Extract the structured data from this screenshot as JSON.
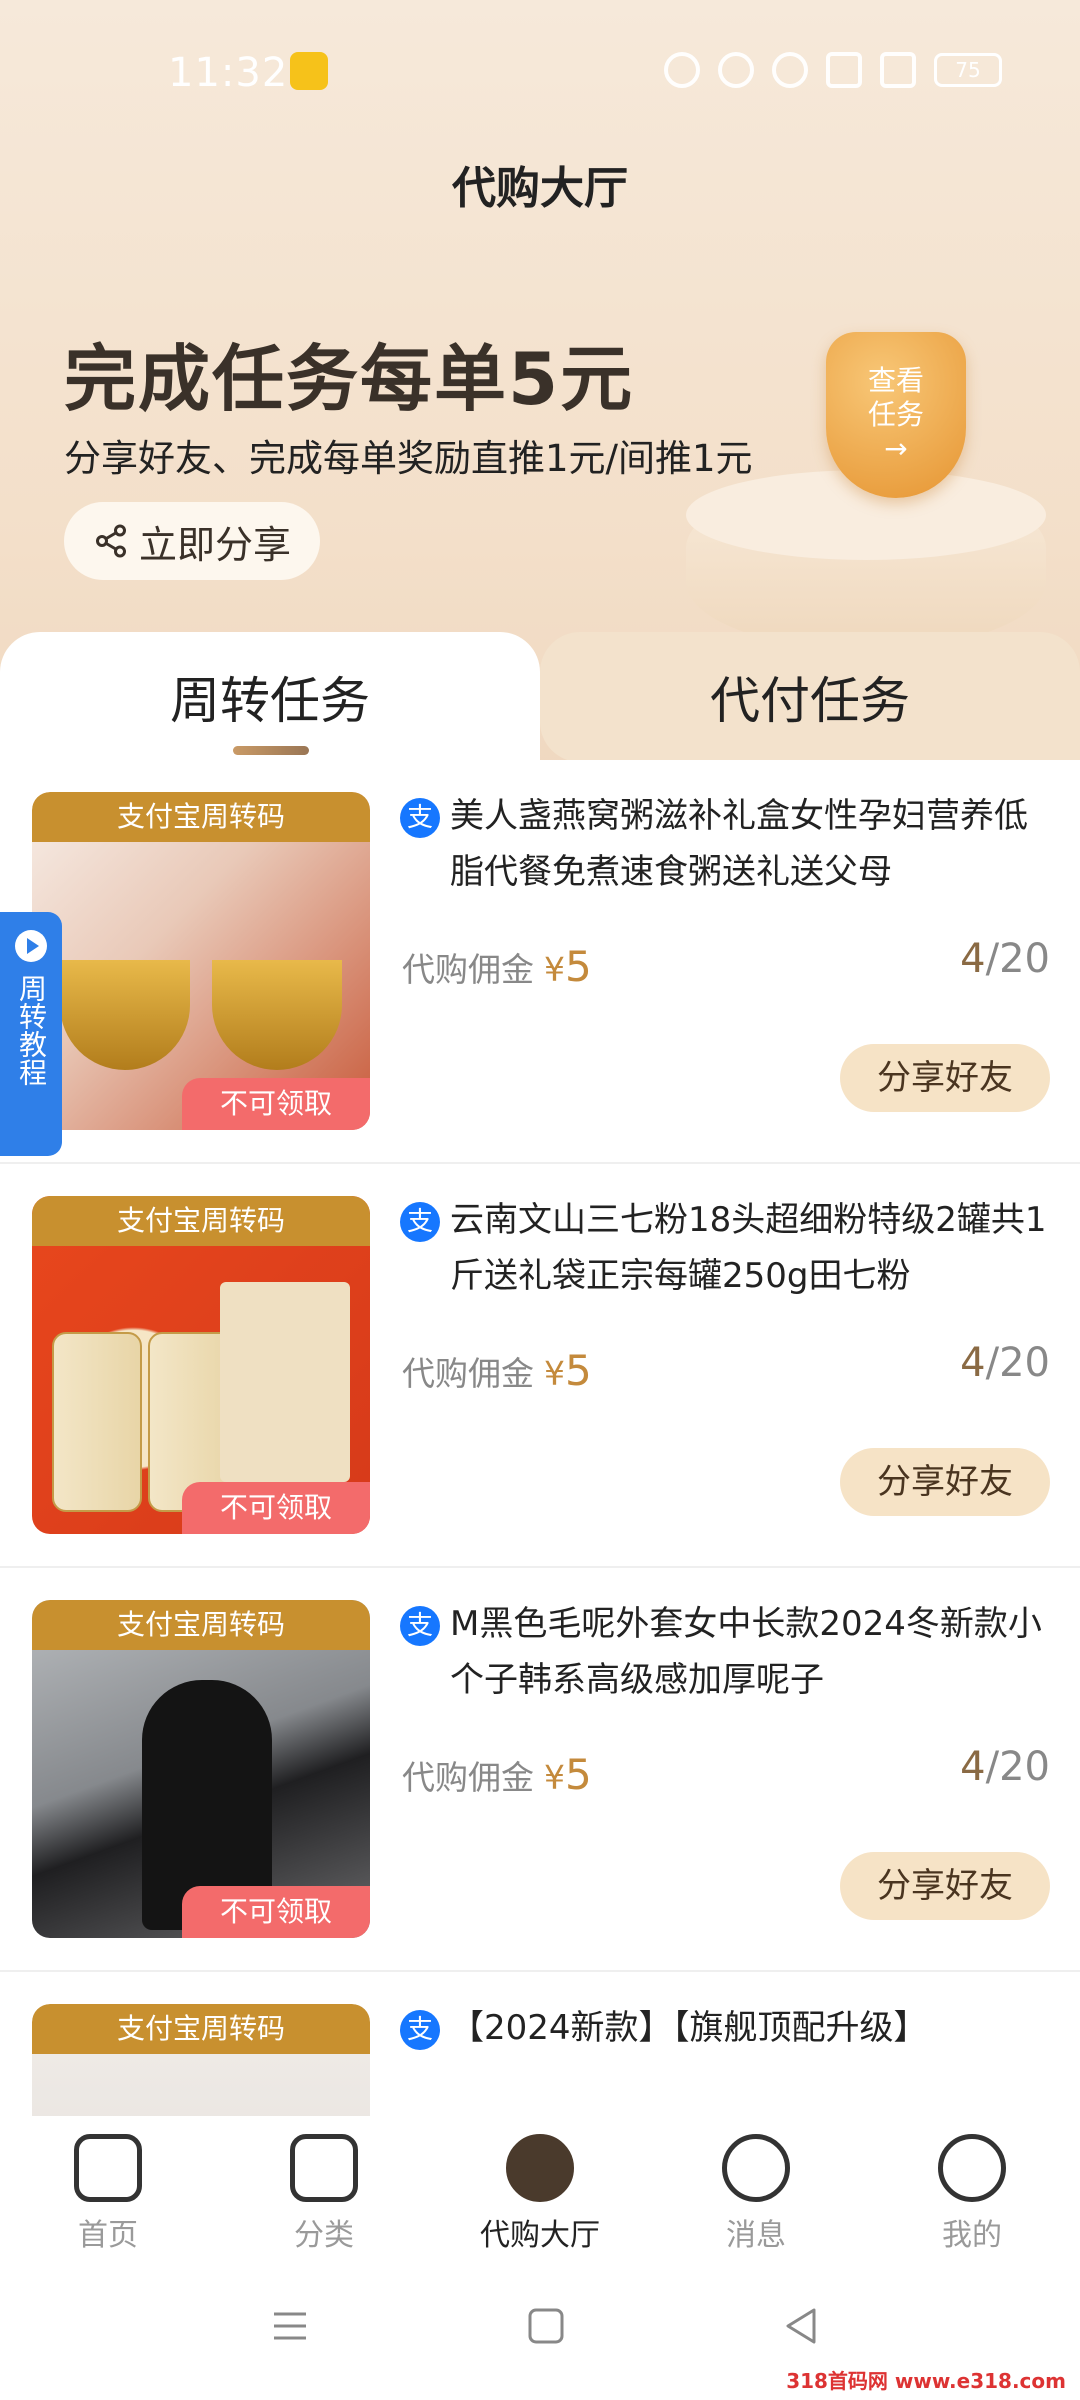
{
  "status_bar": {
    "time": "11:32",
    "battery": "75"
  },
  "header": {
    "title": "代购大厅"
  },
  "promo": {
    "headline": "完成任务每单5元",
    "subtitle": "分享好友、完成每单奖励直推1元/间推1元",
    "share_button": "立即分享",
    "badge_line1": "查看",
    "badge_line2": "任务",
    "badge_arrow": "→"
  },
  "tabs": [
    {
      "label": "周转任务",
      "active": true
    },
    {
      "label": "代付任务",
      "active": false
    }
  ],
  "side_tab": {
    "label": "周转教程"
  },
  "tasks": [
    {
      "banner": "支付宝周转码",
      "flag": "不可领取",
      "title": "美人盏燕窝粥滋补礼盒女性孕妇营养低脂代餐免煮速食粥送礼送父母",
      "commission_label": "代购佣金",
      "currency": "¥",
      "commission": "5",
      "progress": "4",
      "total": "/20",
      "button": "分享好友"
    },
    {
      "banner": "支付宝周转码",
      "flag": "不可领取",
      "title": "云南文山三七粉18头超细粉特级2罐共1斤送礼袋正宗每罐250g田七粉",
      "commission_label": "代购佣金",
      "currency": "¥",
      "commission": "5",
      "progress": "4",
      "total": "/20",
      "button": "分享好友"
    },
    {
      "banner": "支付宝周转码",
      "flag": "不可领取",
      "title": "M黑色毛呢外套女中长款2024冬新款小个子韩系高级感加厚呢子",
      "commission_label": "代购佣金",
      "currency": "¥",
      "commission": "5",
      "progress": "4",
      "total": "/20",
      "button": "分享好友"
    },
    {
      "banner": "支付宝周转码",
      "title": "【2024新款】【旗舰顶配升级】"
    }
  ],
  "bottom_nav": [
    {
      "label": "首页",
      "icon": "home-icon"
    },
    {
      "label": "分类",
      "icon": "category-icon"
    },
    {
      "label": "代购大厅",
      "icon": "shop-hall-icon",
      "active": true
    },
    {
      "label": "消息",
      "icon": "message-icon"
    },
    {
      "label": "我的",
      "icon": "profile-icon"
    }
  ],
  "watermark": "318首码网 www.e318.com"
}
